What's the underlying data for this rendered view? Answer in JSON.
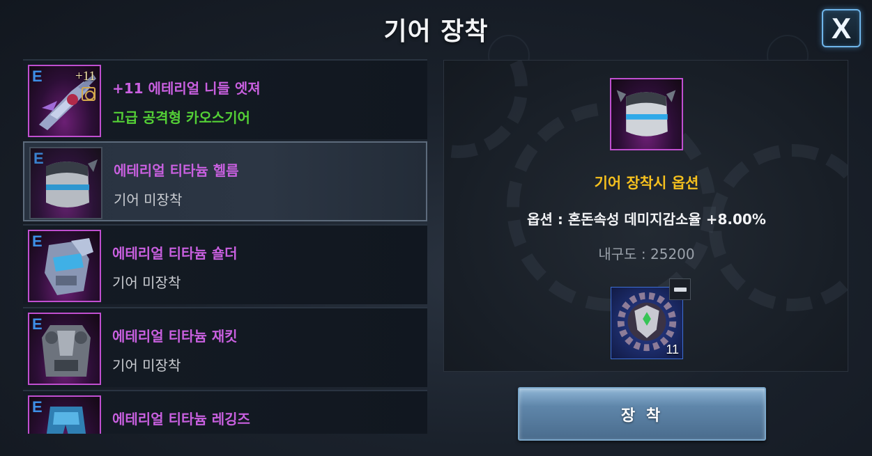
{
  "title": "기어 장착",
  "close_label": "X",
  "gear_list": [
    {
      "grade": "E",
      "enhance": "+11",
      "name": "+11 에테리얼 니들 엣져",
      "sub": "고급 공격형 카오스기어",
      "sub_style": "green",
      "icon": "needle-edger-weapon-icon"
    },
    {
      "grade": "E",
      "name": "에테리얼 티타늄 헬름",
      "sub": "기어 미장착",
      "icon": "helm-icon"
    },
    {
      "grade": "E",
      "name": "에테리얼 티타늄 숄더",
      "sub": "기어 미장착",
      "icon": "shoulder-armor-icon"
    },
    {
      "grade": "E",
      "name": "에테리얼 티타늄 재킷",
      "sub": "기어 미장착",
      "icon": "jacket-armor-icon"
    },
    {
      "grade": "E",
      "name": "에테리얼 티타늄 레깅즈",
      "sub": "",
      "icon": "leggings-armor-icon"
    }
  ],
  "detail": {
    "item_icon": "helm-icon",
    "option_title": "기어 장착시 옵션",
    "option_line": "옵션 : 혼돈속성 데미지감소율 +8.00%",
    "durability": "내구도 : 25200",
    "slot_icon": "gear-emblem-icon",
    "slot_count": "11"
  },
  "equip_label": "장 착",
  "colors": {
    "item_name": "#c960e0",
    "option_title": "#f5c01e",
    "green_sub": "#54d036",
    "grade_e": "#3d8fe6"
  }
}
